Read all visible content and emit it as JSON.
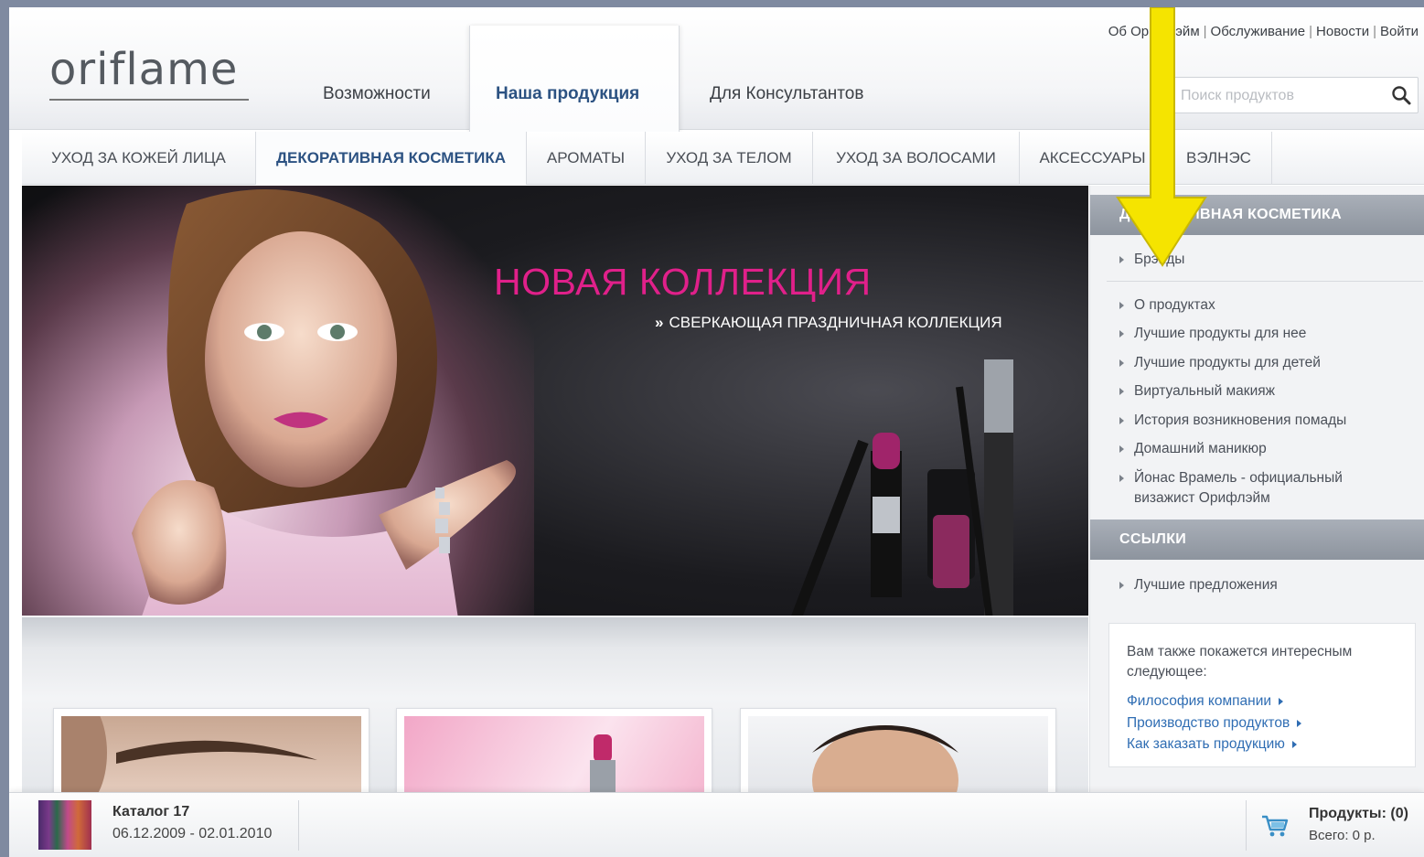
{
  "brand": {
    "logo_text": "oriflame"
  },
  "header": {
    "tabs": [
      {
        "label": "Возможности"
      },
      {
        "label": "Наша продукция"
      },
      {
        "label": "Для Консультантов"
      }
    ],
    "util_links": [
      "Об Орифлэйм",
      "Обслуживание",
      "Новости",
      "Войти"
    ],
    "search": {
      "placeholder": "Поиск продуктов",
      "value": ""
    }
  },
  "catnav": {
    "items": [
      "УХОД ЗА КОЖЕЙ ЛИЦА",
      "ДЕКОРАТИВНАЯ КОСМЕТИКА",
      "АРОМАТЫ",
      "УХОД ЗА ТЕЛОМ",
      "УХОД ЗА ВОЛОСАМИ",
      "АКСЕССУАРЫ",
      "ВЭЛНЭС"
    ],
    "active_index": 1
  },
  "hero": {
    "title": "НОВАЯ КОЛЛЕКЦИЯ",
    "subtitle_prefix": "»",
    "subtitle": "СВЕРКАЮЩАЯ ПРАЗДНИЧНАЯ КОЛЛЕКЦИЯ",
    "title_color": "#e0208a"
  },
  "sidebar": {
    "section1_title": "ДЕКОРАТИВНАЯ КОСМЕТИКА",
    "section1_items": [
      "Брэнды",
      "О продуктах",
      "Лучшие продукты для нее",
      "Лучшие продукты для детей",
      "Виртуальный макияж",
      "История возникновения помады",
      "Домашний маникюр",
      "Йонас Врамель - официальный визажист Орифлэйм"
    ],
    "section2_title": "ССЫЛКИ",
    "section2_items": [
      "Лучшие предложения"
    ],
    "interesting": {
      "text": "Вам также покажется интересным следующее:",
      "links": [
        "Философия компании",
        "Производство продуктов",
        "Как заказать продукцию"
      ]
    }
  },
  "footer": {
    "catalog_title": "Каталог 17",
    "catalog_dates": "06.12.2009 - 02.01.2010",
    "cart_title": "Продукты: (0)",
    "cart_total": "Всего: 0 р."
  },
  "colors": {
    "annotation_arrow": "#f5e400",
    "link": "#2f6db3",
    "active_category": "#2c5282"
  },
  "icons": [
    "search-icon",
    "cart-icon",
    "triangle-bullet-icon",
    "annotation-arrow-icon"
  ]
}
